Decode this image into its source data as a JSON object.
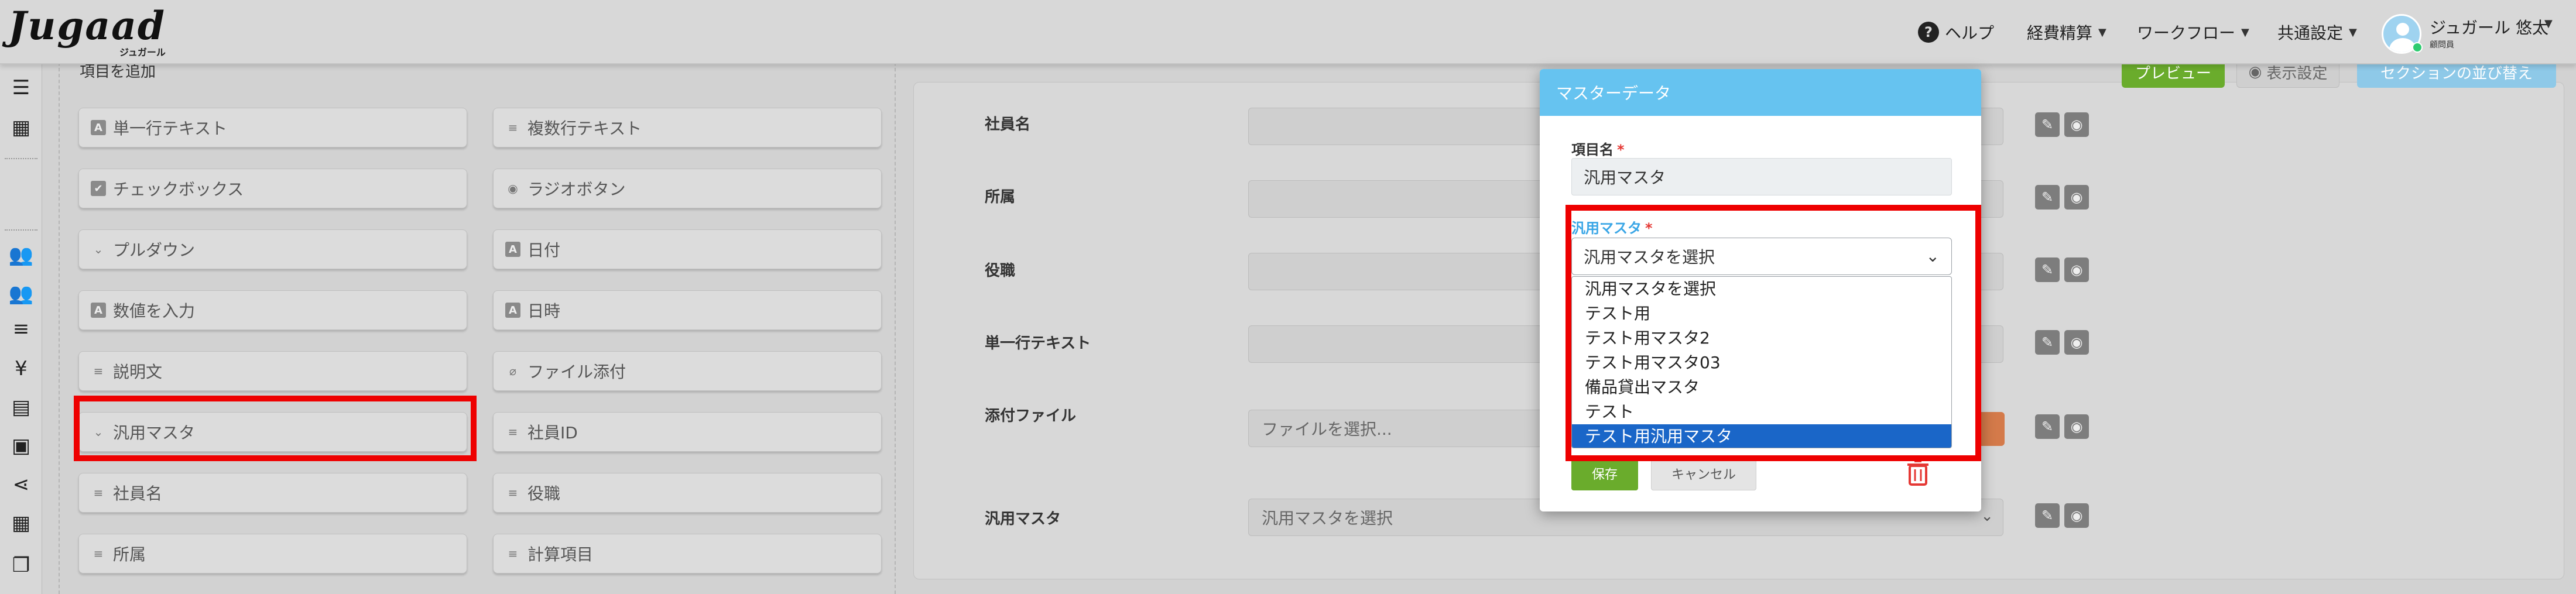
{
  "header": {
    "logo_text": "Jugaad",
    "logo_sub": "ジュガール",
    "nav": {
      "help": "ヘルプ",
      "expense": "経費精算",
      "workflow": "ワークフロー",
      "common_settings": "共通設定"
    },
    "user": {
      "name": "ジュガール 悠太",
      "role": "顧問員"
    }
  },
  "left_panel": {
    "title": "項目を追加",
    "items": [
      {
        "label": "単一行テキスト",
        "icon": "text-box-icon"
      },
      {
        "label": "複数行テキスト",
        "icon": "multiline-icon"
      },
      {
        "label": "チェックボックス",
        "icon": "checkbox-icon"
      },
      {
        "label": "ラジオボタン",
        "icon": "radio-icon"
      },
      {
        "label": "プルダウン",
        "icon": "chevron-down-icon"
      },
      {
        "label": "日付",
        "icon": "text-box-icon"
      },
      {
        "label": "数値を入力",
        "icon": "text-box-icon"
      },
      {
        "label": "日時",
        "icon": "text-box-icon"
      },
      {
        "label": "説明文",
        "icon": "lines-icon"
      },
      {
        "label": "ファイル添付",
        "icon": "paperclip-icon"
      },
      {
        "label": "汎用マスタ",
        "icon": "chevron-down-icon"
      },
      {
        "label": "社員ID",
        "icon": "lines-icon"
      },
      {
        "label": "社員名",
        "icon": "lines-icon"
      },
      {
        "label": "役職",
        "icon": "lines-icon"
      },
      {
        "label": "所属",
        "icon": "lines-icon"
      },
      {
        "label": "計算項目",
        "icon": "lines-icon"
      }
    ]
  },
  "editor": {
    "toolbar": {
      "preview": "プレビュー",
      "display_settings": "表示設定",
      "section": "セクションの並び替え"
    },
    "rows": [
      {
        "label": "社員名"
      },
      {
        "label": "所属"
      },
      {
        "label": "役職"
      },
      {
        "label": "単一行テキスト"
      },
      {
        "label": "添付ファイル",
        "placeholder": "ファイルを選択..."
      },
      {
        "label": "汎用マスタ",
        "value": "汎用マスタを選択"
      }
    ]
  },
  "modal": {
    "title": "マスターデータ",
    "field_name_label": "項目名",
    "field_name_value": "汎用マスタ",
    "master_label": "汎用マスタ",
    "master_selected": "汎用マスタを選択",
    "required_mark": "*",
    "options": [
      "汎用マスタを選択",
      "テスト用",
      "テスト用マスタ2",
      "テスト用マスタ03",
      "備品貸出マスタ",
      "テスト",
      "テスト用汎用マスタ"
    ],
    "highlighted_option": "テスト用汎用マスタ",
    "save": "保存",
    "cancel": "キャンセル"
  },
  "colors": {
    "modal_header": "#66c3f0",
    "save": "#6aac2c",
    "highlight": "#ee0000",
    "selected_option": "#1a66c8"
  }
}
